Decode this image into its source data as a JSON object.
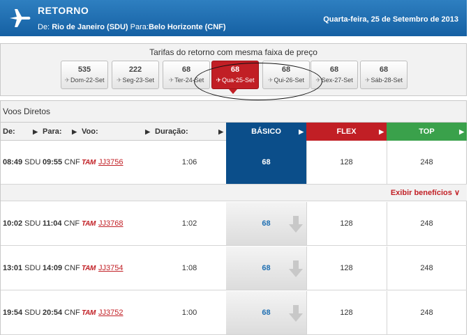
{
  "header": {
    "title": "RETORNO",
    "de_label": "De:",
    "origin": "Rio de Janeiro (SDU)",
    "para_label": "Para:",
    "destination": "Belo Horizonte (CNF)",
    "date": "Quarta-feira, 25 de Setembro de 2013"
  },
  "fares": {
    "title": "Tarifas do retorno com mesma faixa de preço",
    "days": [
      {
        "price": "535",
        "label": "Dom-22-Set",
        "selected": false
      },
      {
        "price": "222",
        "label": "Seg-23-Set",
        "selected": false
      },
      {
        "price": "68",
        "label": "Ter-24-Set",
        "selected": false
      },
      {
        "price": "68",
        "label": "Qua-25-Set",
        "selected": true
      },
      {
        "price": "68",
        "label": "Qui-26-Set",
        "selected": false
      },
      {
        "price": "68",
        "label": "Sex-27-Set",
        "selected": false
      },
      {
        "price": "68",
        "label": "Sáb-28-Set",
        "selected": false
      }
    ]
  },
  "flights": {
    "section_title": "Voos Diretos",
    "headers": {
      "de": "De:",
      "para": "Para:",
      "voo": "Voo:",
      "duracao": "Duração:",
      "basico": "BÁSICO",
      "flex": "FLEX",
      "top": "TOP"
    },
    "colors": {
      "basico": "#0b4e8a",
      "flex": "#c11f25",
      "top": "#3aa14b"
    },
    "benefits_link": "Exibir benefícios",
    "rows": [
      {
        "dep_time": "08:49",
        "dep_ap": "SDU",
        "arr_time": "09:55",
        "arr_ap": "CNF",
        "airline": "TAM",
        "flight": "JJ3756",
        "duration": "1:06",
        "basico": "68",
        "flex": "128",
        "top": "248",
        "selected": true
      },
      {
        "dep_time": "10:02",
        "dep_ap": "SDU",
        "arr_time": "11:04",
        "arr_ap": "CNF",
        "airline": "TAM",
        "flight": "JJ3768",
        "duration": "1:02",
        "basico": "68",
        "flex": "128",
        "top": "248",
        "selected": false
      },
      {
        "dep_time": "13:01",
        "dep_ap": "SDU",
        "arr_time": "14:09",
        "arr_ap": "CNF",
        "airline": "TAM",
        "flight": "JJ3754",
        "duration": "1:08",
        "basico": "68",
        "flex": "128",
        "top": "248",
        "selected": false
      },
      {
        "dep_time": "19:54",
        "dep_ap": "SDU",
        "arr_time": "20:54",
        "arr_ap": "CNF",
        "airline": "TAM",
        "flight": "JJ3752",
        "duration": "1:00",
        "basico": "68",
        "flex": "128",
        "top": "248",
        "selected": false
      }
    ]
  }
}
